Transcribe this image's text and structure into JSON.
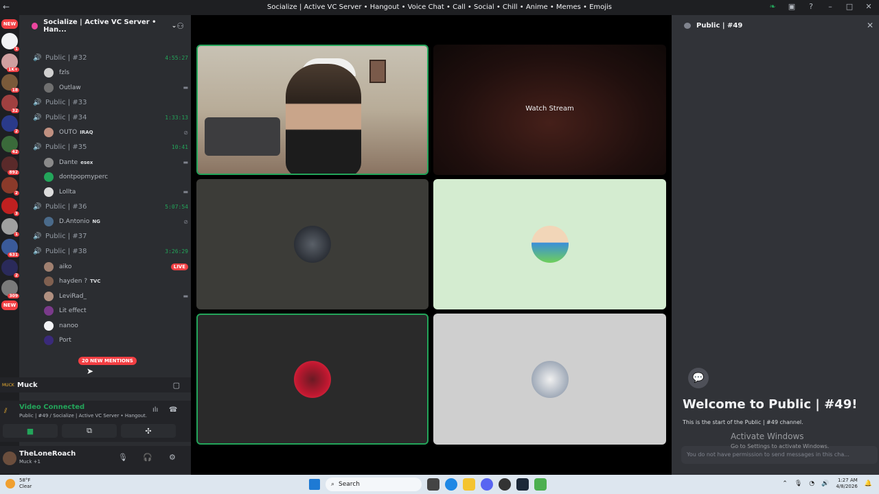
{
  "window": {
    "title": "Socialize | Active VC Server • Hangout • Voice Chat • Call • Social • Chill • Anime • Memes • Emojis"
  },
  "server": {
    "name": "Socialize | Active VC Server • Han...",
    "server_badges": [
      "NEW",
      "1",
      "1K+",
      "18",
      "32",
      "2",
      "42",
      "892",
      "2",
      "3",
      "1",
      "631",
      "2",
      "309",
      "NEW"
    ]
  },
  "channels": [
    {
      "name": "Public | #32",
      "time": "4:55:27",
      "users": [
        {
          "name": "fzls",
          "tag": "",
          "right": ""
        },
        {
          "name": "Outlaw",
          "tag": "",
          "right": "video"
        }
      ]
    },
    {
      "name": "Public | #33",
      "time": "",
      "users": []
    },
    {
      "name": "Public | #34",
      "time": "1:33:13",
      "users": [
        {
          "name": "OUTO",
          "tag": "IRAQ",
          "right": "mute"
        }
      ]
    },
    {
      "name": "Public | #35",
      "time": "10:41",
      "users": [
        {
          "name": "Dante",
          "tag": "esex",
          "right": "video"
        },
        {
          "name": "dontpopmyperc",
          "tag": "",
          "right": ""
        },
        {
          "name": "Lollta",
          "tag": "",
          "right": "video"
        }
      ]
    },
    {
      "name": "Public | #36",
      "time": "5:07:54",
      "users": [
        {
          "name": "D.Antonio",
          "tag": "NG",
          "right": "mute"
        }
      ]
    },
    {
      "name": "Public | #37",
      "time": "",
      "users": []
    },
    {
      "name": "Public | #38",
      "time": "3:26:29",
      "users": [
        {
          "name": "aiko",
          "tag": "",
          "right": "LIVE"
        },
        {
          "name": "hayden ?",
          "tag": "TVC",
          "right": ""
        },
        {
          "name": "LeviRad_",
          "tag": "",
          "right": "video"
        },
        {
          "name": "Lit effect",
          "tag": "",
          "right": ""
        },
        {
          "name": "nanoo",
          "tag": "",
          "right": ""
        },
        {
          "name": "Port",
          "tag": "",
          "right": ""
        }
      ]
    }
  ],
  "mentions": "20 NEW MENTIONS",
  "muck": {
    "logo": "MUCK",
    "name": "Muck"
  },
  "voice": {
    "status": "Video Connected",
    "location": "Public | #49 / Socialize | Active VC Server • Hangout..."
  },
  "user": {
    "name": "TheLoneRoach",
    "status": "Muck +1"
  },
  "stage": {
    "watch_label": "Watch Stream"
  },
  "right_panel": {
    "channel": "Public | #49",
    "welcome": "Welcome to Public | #49!",
    "start": "This is the start of the Public | #49 channel.",
    "activate_title": "Activate Windows",
    "activate_sub": "Go to Settings to activate Windows.",
    "input_placeholder": "You do not have permission to send messages in this cha..."
  },
  "taskbar": {
    "temp": "58°F",
    "condition": "Clear",
    "search": "Search",
    "time": "1:27 AM",
    "date": "4/8/2026"
  },
  "colors": {
    "green": "#23a55a",
    "red": "#f23f43",
    "bg": "#2b2d31"
  }
}
